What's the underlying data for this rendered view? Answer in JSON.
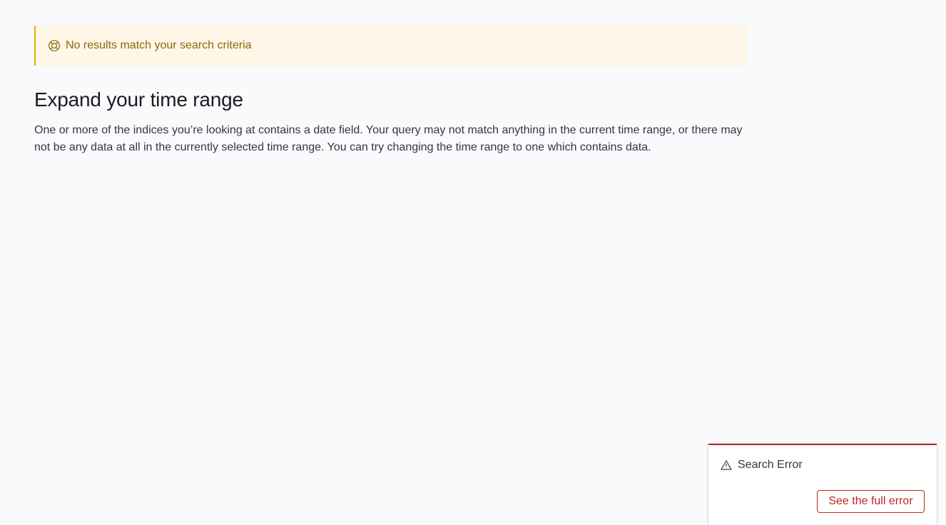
{
  "callout": {
    "icon": "help-lifebuoy-icon",
    "text": "No results match your search criteria",
    "accent_color": "#f5a700",
    "background_color": "#fef6e6"
  },
  "main": {
    "heading": "Expand your time range",
    "description": "One or more of the indices you’re looking at contains a date field. Your query may not match anything in the current time range, or there may not be any data at all in the currently selected time range. You can try changing the time range to one which contains data."
  },
  "toast": {
    "icon": "alert-triangle-icon",
    "title": "Search Error",
    "button_label": "See the full error",
    "accent_color": "#bd271e"
  }
}
